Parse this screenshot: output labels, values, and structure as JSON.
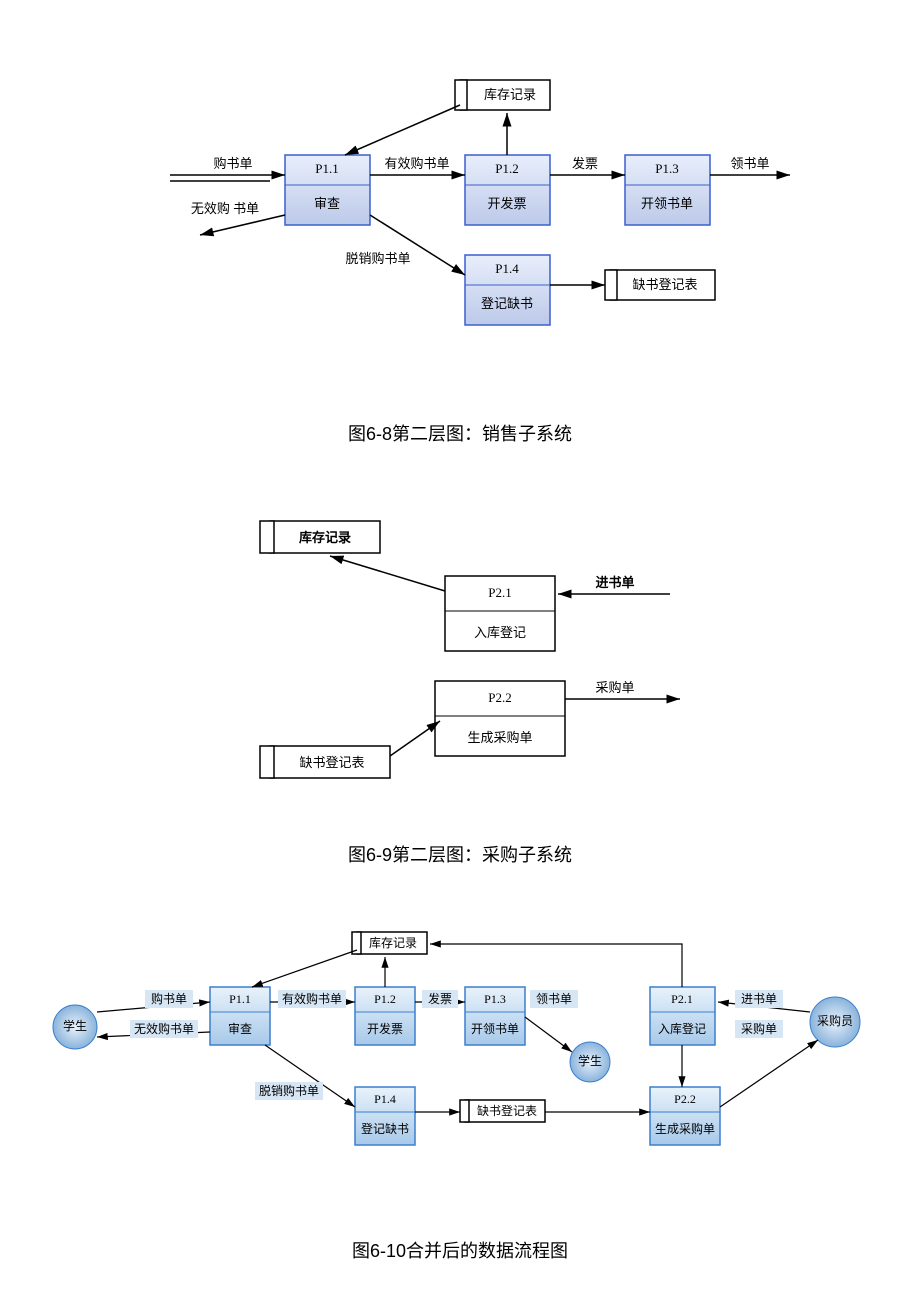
{
  "captions": {
    "fig68": "图6-8第二层图：销售子系统",
    "fig69": "图6-9第二层图：采购子系统",
    "fig610": "图6-10合并后的数据流程图"
  },
  "diagram68": {
    "processes": {
      "p11": {
        "id": "P1.1",
        "name": "审查"
      },
      "p12": {
        "id": "P1.2",
        "name": "开发票"
      },
      "p13": {
        "id": "P1.3",
        "name": "开领书单"
      },
      "p14": {
        "id": "P1.4",
        "name": "登记缺书"
      }
    },
    "datastores": {
      "inventory": "库存记录",
      "shortage": "缺书登记表"
    },
    "flows": {
      "in1": "购书单",
      "rej": "无效购 书单",
      "valid": "有效购书单",
      "oos": "脱销购书单",
      "invoice": "发票",
      "receipt": "领书单"
    }
  },
  "diagram69": {
    "processes": {
      "p21": {
        "id": "P2.1",
        "name": "入库登记"
      },
      "p22": {
        "id": "P2.2",
        "name": "生成采购单"
      }
    },
    "datastores": {
      "inventory": "库存记录",
      "shortage": "缺书登记表"
    },
    "flows": {
      "in_stock": "进书单",
      "po": "采购单"
    }
  },
  "diagram610": {
    "externals": {
      "student_left": "学生",
      "student_mid": "学生",
      "buyer": "采购员"
    },
    "processes": {
      "p11": {
        "id": "P1.1",
        "name": "审查"
      },
      "p12": {
        "id": "P1.2",
        "name": "开发票"
      },
      "p13": {
        "id": "P1.3",
        "name": "开领书单"
      },
      "p14": {
        "id": "P1.4",
        "name": "登记缺书"
      },
      "p21": {
        "id": "P2.1",
        "name": "入库登记"
      },
      "p22": {
        "id": "P2.2",
        "name": "生成采购单"
      }
    },
    "datastores": {
      "inventory": "库存记录",
      "shortage": "缺书登记表"
    },
    "flows": {
      "in1": "购书单",
      "rej": "无效购书单",
      "valid": "有效购书单",
      "oos": "脱销购书单",
      "invoice": "发票",
      "receipt": "领书单",
      "in_stock": "进书单",
      "po": "采购单"
    }
  }
}
